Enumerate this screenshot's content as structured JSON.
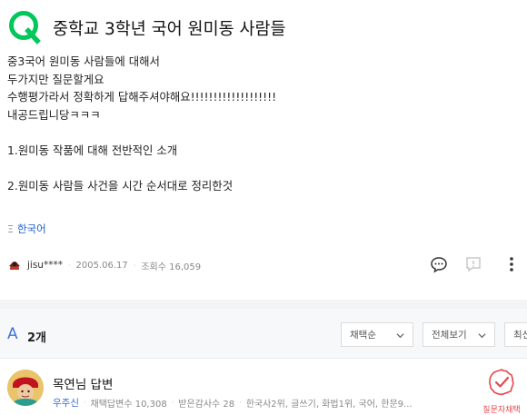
{
  "question": {
    "title": "중학교 3학년 국어 원미동 사람들",
    "body_lines": [
      "중3국어 원미동 사람들에 대해서",
      "두가지만 질문할게요",
      "수행평가라서 정확하게 답해주셔야해요!!!!!!!!!!!!!!!!!!!",
      "내공드립니당ㅋㅋㅋ",
      "",
      "1.원미동 작품에 대해 전반적인 소개",
      "",
      "2.원미동 사람들 사건을 시간 순서대로 정리한것"
    ],
    "tag_prefix": "Ξ",
    "tag": "한국어",
    "author": "jisu****",
    "date": "2005.06.17",
    "views": "조회수 16,059"
  },
  "answers_header": {
    "icon_letter": "A",
    "count": "2개",
    "sort_select": "채택순",
    "view_select": "전체보기",
    "third_select": "최신"
  },
  "answer": {
    "title": "목연님 답변",
    "author": "우주신",
    "adopted": "채택답변수 10,308",
    "thanks": "받은감사수 28",
    "categories": "한국사2위, 글쓰기, 화법1위, 국어, 한문9...",
    "pick_label": "질문자채택"
  },
  "colors": {
    "brand_green": "#03c75a",
    "link_blue": "#1d5fc9",
    "accent_red": "#e5484d"
  }
}
